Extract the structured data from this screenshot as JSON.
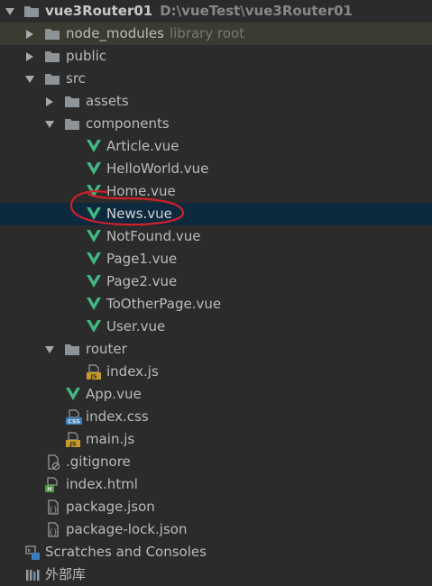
{
  "project": {
    "name": "vue3Router01",
    "path": "D:\\vueTest\\vue3Router01"
  },
  "tree": {
    "node_modules": {
      "label": "node_modules",
      "hint": "library root"
    },
    "public": "public",
    "src": "src",
    "assets": "assets",
    "components": "components",
    "files_components": [
      "Article.vue",
      "HelloWorld.vue",
      "Home.vue",
      "News.vue",
      "NotFound.vue",
      "Page1.vue",
      "Page2.vue",
      "ToOtherPage.vue",
      "User.vue"
    ],
    "router": "router",
    "router_index": "index.js",
    "app": "App.vue",
    "index_css": "index.css",
    "main_js": "main.js",
    "gitignore": ".gitignore",
    "index_html": "index.html",
    "package_json": "package.json",
    "package_lock": "package-lock.json",
    "scratches": "Scratches and Consoles",
    "external_libs": "外部库"
  },
  "colors": {
    "vue_green": "#41b883",
    "folder": "#8e9398",
    "selected_bg": "#0d293e",
    "highlight_bg": "#3b3b32",
    "annotation_red": "#d0202a"
  },
  "icons": {
    "folder": "folder-icon",
    "vue": "vue-file-icon",
    "js": "js-file-icon",
    "css": "css-file-icon",
    "html": "html-file-icon",
    "generic": "generic-file-icon",
    "scratches": "scratches-icon",
    "library": "library-icon"
  }
}
